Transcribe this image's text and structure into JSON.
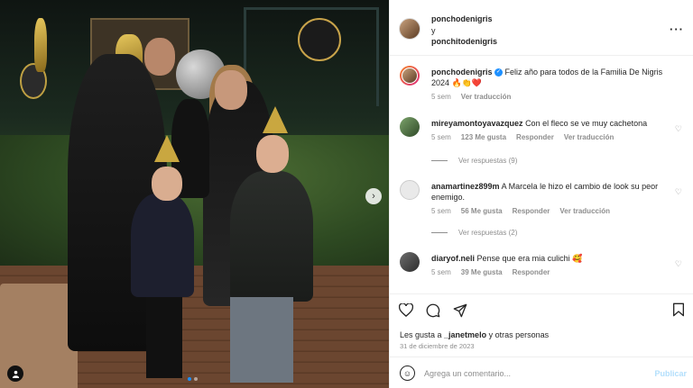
{
  "header": {
    "author": "ponchodenigris",
    "connector": "y",
    "collaborator": "ponchitodenigris",
    "more_icon": "more-horizontal-icon"
  },
  "caption": {
    "username": "ponchodenigris",
    "verified": "✓",
    "text": "Feliz año para todos de la Familia De Nigris 2024 🔥👏❤️",
    "time": "5 sem",
    "translate": "Ver traducción"
  },
  "comments": [
    {
      "username": "mireyamontoyavazquez",
      "text": "Con el fleco se ve muy cachetona",
      "time": "5 sem",
      "likes": "123 Me gusta",
      "reply": "Responder",
      "translate": "Ver traducción",
      "replies": "Ver respuestas (9)"
    },
    {
      "username": "anamartinez899m",
      "text": "A Marcela le hizo el cambio de look su peor enemigo.",
      "time": "5 sem",
      "likes": "56 Me gusta",
      "reply": "Responder",
      "translate": "Ver traducción",
      "replies": "Ver respuestas (2)"
    },
    {
      "username": "diaryof.neli",
      "text": "Pense que era mia culichi 🥰",
      "time": "5 sem",
      "likes": "39 Me gusta",
      "reply": "Responder"
    }
  ],
  "actions": {
    "like_icon": "heart-icon",
    "comment_icon": "comment-icon",
    "share_icon": "share-icon",
    "save_icon": "bookmark-icon",
    "likes_text_prefix": "Les gusta a ",
    "likes_user": "_janetmelo",
    "likes_text_suffix": " y otras personas",
    "date": "31 de diciembre de 2023"
  },
  "add_comment": {
    "placeholder": "Agrega un comentario...",
    "publish": "Publicar"
  },
  "photo": {
    "next_icon": "chevron-right-icon",
    "tag_icon": "user-tag-icon",
    "slides": 2,
    "current_slide": 1
  }
}
